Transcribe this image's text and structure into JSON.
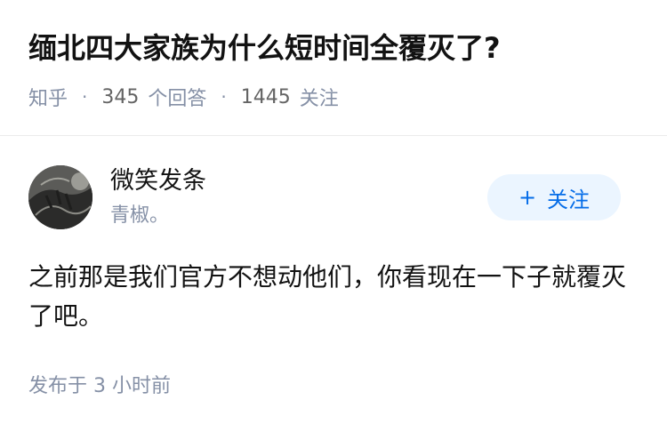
{
  "question": {
    "title": "缅北四大家族为什么短时间全覆灭了?",
    "source": "知乎",
    "answer_count": "345",
    "answer_label": "个回答",
    "follower_count": "1445",
    "follower_label": "关注"
  },
  "answer": {
    "author": {
      "name": "微笑发条",
      "bio": "青椒。",
      "avatar": "avatar-image"
    },
    "follow_button": {
      "icon": "plus-icon",
      "plus_glyph": "+",
      "label": "关注"
    },
    "content": "之前那是我们官方不想动他们，你看现在一下子就覆灭了吧。",
    "published": "发布于 3 小时前"
  },
  "colors": {
    "accent": "#056de8",
    "accent_bg": "#ebf5ff",
    "meta_text": "#8590a6",
    "primary_text": "#121212"
  }
}
